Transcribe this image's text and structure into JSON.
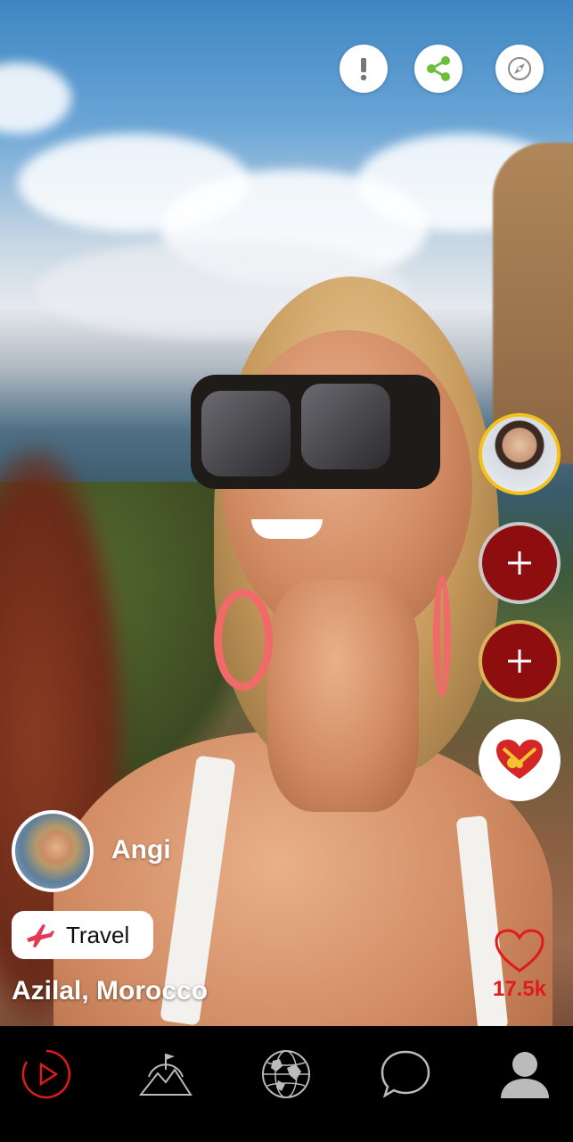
{
  "post": {
    "author_name": "Angi",
    "category_label": "Travel",
    "location": "Azilal, Morocco",
    "likes": "17.5k"
  },
  "top_actions": [
    "report-icon",
    "share-icon",
    "compass-icon"
  ],
  "side_actions": [
    "creator-avatar",
    "add-button",
    "add-button",
    "gift-heart-icon"
  ],
  "nav": {
    "items": [
      "play-icon",
      "mountain-icon",
      "globe-icon",
      "chat-icon",
      "profile-icon"
    ],
    "active_index": 0
  },
  "colors": {
    "accent": "#e11a1a",
    "plus_button": "#8e0e10",
    "avatar_ring": "#f4c11a",
    "share_green": "#6cbf3a",
    "nav_bg": "#000000"
  }
}
